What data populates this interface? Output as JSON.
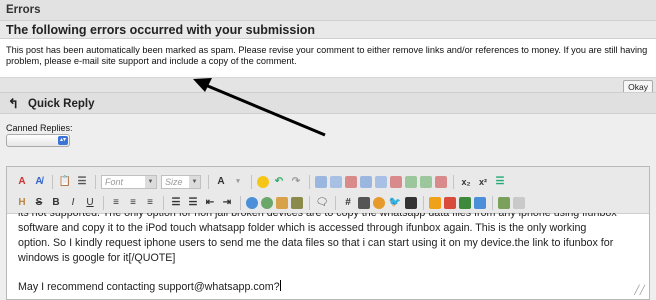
{
  "errors": {
    "title": "Errors",
    "subtitle": "The following errors occurred with your submission",
    "message": "This post has been automatically been marked as spam. Please revise your comment to either remove links and/or references to money. If you are still having problem, please e-mail site support and include a copy of the comment.",
    "okay_label": "Okay"
  },
  "quick_reply": {
    "title": "Quick Reply",
    "canned_label": "Canned Replies:",
    "canned_value": ""
  },
  "toolbar": {
    "font_placeholder": "Font",
    "size_placeholder": "Size"
  },
  "editor": {
    "line1": "its not supported. The only option for non jail broken devices are to copy the whatsapp data files from any iphone using ifunbox",
    "line2": "software and copy it to the iPod touch whatsapp folder which is accessed through ifunbox again. This is the only working",
    "line3": "option. So I kindly request iphone users to send me the data files so that i can start using it on my device.the link to ifunbox for",
    "line4": "windows is google for it[/QUOTE]",
    "line5": "May I recommend contacting support@whatsapp.com?"
  },
  "colors": {
    "header_bg": "#e2e2e2",
    "panel_bg": "#eeeeee",
    "select_arrow": "#3b73d6"
  }
}
